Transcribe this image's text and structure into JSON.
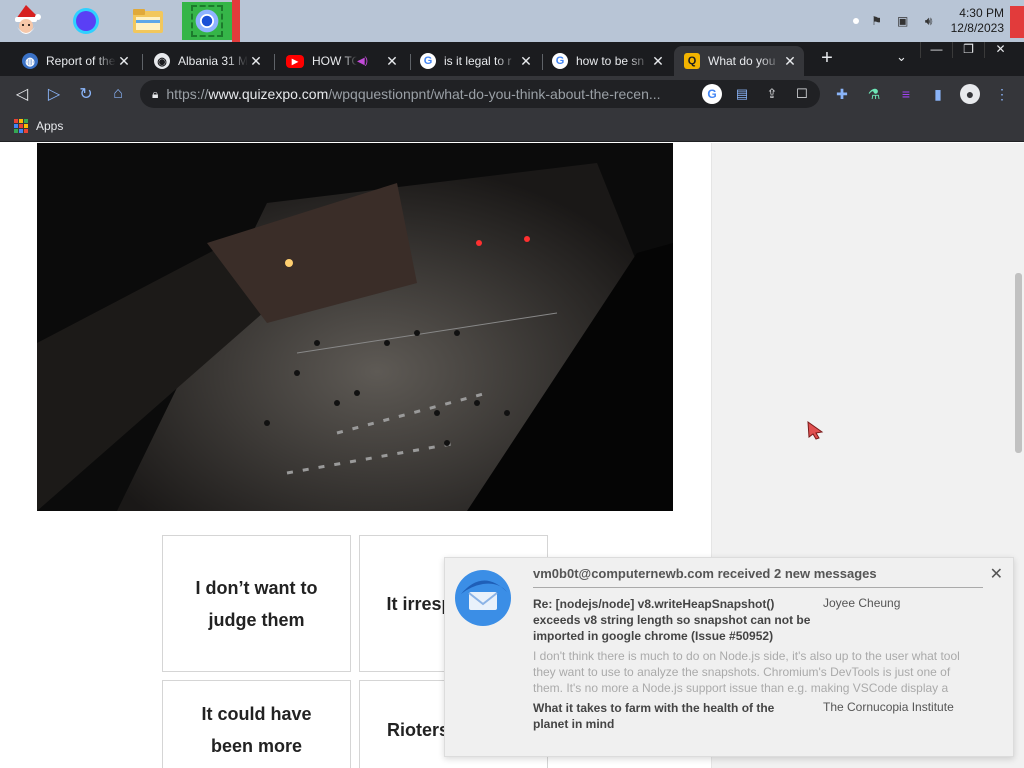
{
  "taskbar": {
    "apps": [
      "Santa",
      "Circle app",
      "File Explorer",
      "Google Chrome"
    ],
    "clock_time": "4:30 PM",
    "clock_date": "12/8/2023"
  },
  "tabs": [
    {
      "title": "Report of the",
      "icon": "un-icon"
    },
    {
      "title": "Albania 31 M",
      "icon": "globe-icon"
    },
    {
      "title": "HOW TO",
      "icon": "youtube-icon"
    },
    {
      "title": "is it legal to r",
      "icon": "google-icon"
    },
    {
      "title": "how to be sn",
      "icon": "google-icon"
    },
    {
      "title": "What do you",
      "icon": "quizexpo-icon",
      "active": true
    }
  ],
  "toolbar": {
    "url_prefix": "https://",
    "url_host": "www.quizexpo.com",
    "url_path": "/wpqquestionpnt/what-do-you-think-about-the-recen..."
  },
  "bookmarks": {
    "apps_label": "Apps"
  },
  "answers": [
    "I don’t want to judge them",
    "It irrespo unacc",
    "It could have been more",
    "Rioters of point"
  ],
  "notification": {
    "header": "vm0b0t@computernewb.com received 2 new messages",
    "messages": [
      {
        "subject": "Re: [nodejs/node] v8.writeHeapSnapshot() exceeds v8 string length so snapshot can not be imported in google chrome (Issue #50952)",
        "from": "Joyee Cheung",
        "body": "I don't think there is much to do on Node.js side, it's also up to the user what tool they want to use to analyze the snapshots. Chromium's DevTools is just one of them. It's no more a Node.js support issue than e.g. making VSCode display a large"
      },
      {
        "subject": "What it takes to farm with the health of the planet in mind",
        "from": "The Cornucopia Institute"
      }
    ]
  },
  "colors": {
    "taskbar": "#b8c5d6",
    "tabstrip": "#1b1c1f",
    "toolbar": "#35363a",
    "accent": "#8ab4f8"
  }
}
